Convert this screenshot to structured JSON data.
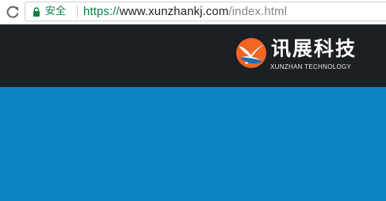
{
  "browser": {
    "security_label": "安全",
    "url": {
      "scheme": "https://",
      "host": "www.xunzhankj.com",
      "path": "/index.html"
    },
    "icons": [
      "reload-icon",
      "lock-icon"
    ]
  },
  "site": {
    "logo": {
      "name_cn": "讯展科技",
      "name_en": "XUNZHAN TECHNOLOGY",
      "mark_colors": [
        "#f26522",
        "#1d6fb8",
        "#ffffff"
      ]
    },
    "colors": {
      "header_bg": "#1c1f24",
      "hero_bg": "#0f82c6"
    }
  }
}
